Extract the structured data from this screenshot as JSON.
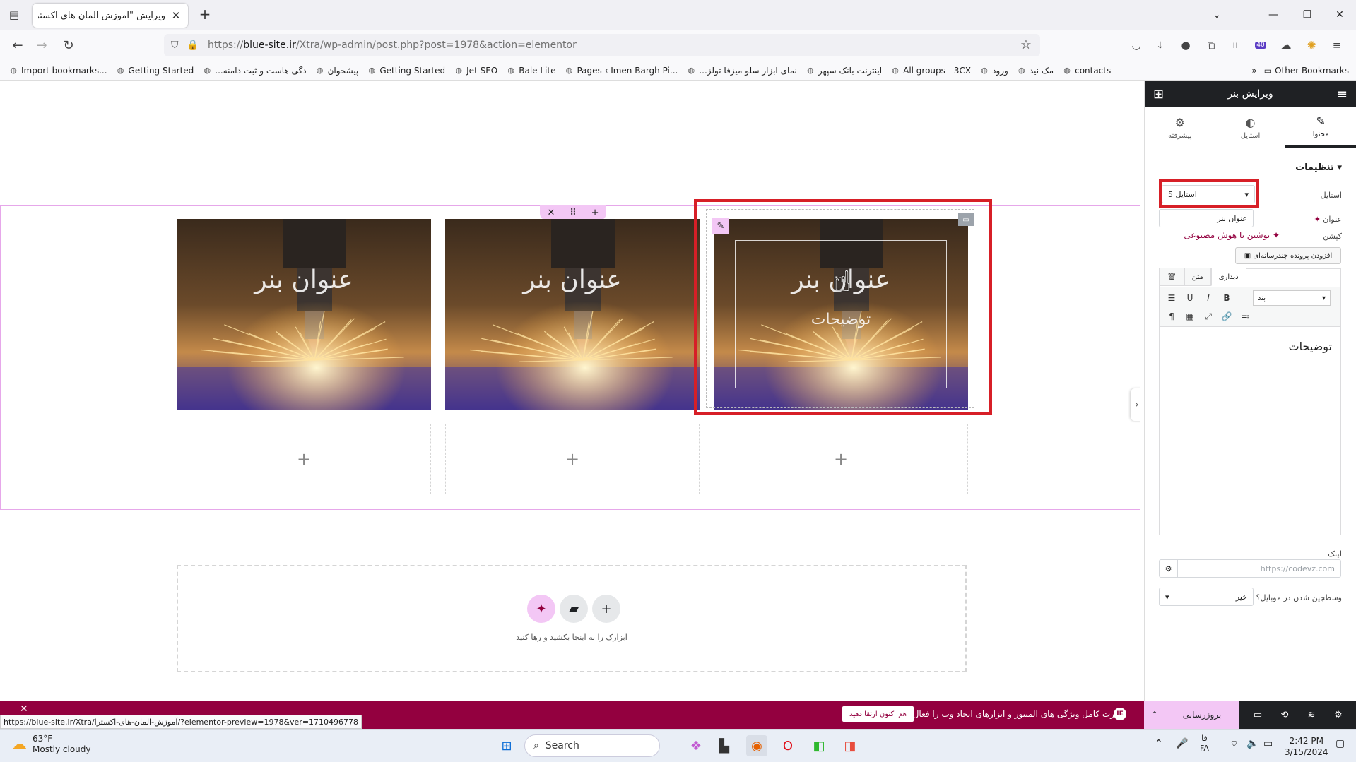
{
  "browser": {
    "tab_title": "ویرایش \"آموزش المان های اکسترا –",
    "url_prefix": "https://",
    "url_domain": "blue-site.ir",
    "url_path": "/Xtra/wp-admin/post.php?post=1978&action=elementor",
    "profile_badge": "40",
    "bookmarks": [
      "Import bookmarks...",
      "Getting Started",
      "...دگی هاست و ثبت دامنه",
      "پیشخوان",
      "Getting Started",
      "Jet SEO",
      "Bale Lite",
      "Pages ‹ Imen Bargh Pi...",
      "...نمای ابزار سلو میزفا تولز",
      "اینترنت بانک سپهر",
      "All groups - 3CX",
      "ورود",
      "مک نید",
      "contacts"
    ],
    "other_bookmarks": "Other Bookmarks"
  },
  "canvas": {
    "banners": [
      {
        "title": "عنوان بنر",
        "description": ""
      },
      {
        "title": "عنوان بنر",
        "description": ""
      },
      {
        "title": "عنوان بنر",
        "description": "توضیحات"
      }
    ],
    "add_symbol": "+",
    "drop_zone_text": "ابزارک را به اینجا بکشید و رها کنید"
  },
  "panel": {
    "title": "ویرایش بنر",
    "tabs": [
      {
        "label": "محتوا",
        "icon": "pencil-icon"
      },
      {
        "label": "استایل",
        "icon": "contrast-icon"
      },
      {
        "label": "پیشرفته",
        "icon": "gear-icon"
      }
    ],
    "section_title": "تنظیمات",
    "style_label": "استایل",
    "style_value": "استایل 5",
    "title_label": "عنوان",
    "title_value": "عنوان بنر",
    "caption_label": "کپشن",
    "ai_link": "نوشتن با هوش مصنوعی",
    "add_media": "افزودن پرونده چندرسانه‌ای",
    "editor_tab_visual": "دیداری",
    "editor_tab_text": "متن",
    "paragraph": "بند",
    "editor_content": "توضیحات",
    "link_label": "لینک",
    "link_placeholder": "https://codevz.com",
    "center_mobile_label": "وسطچین شدن در موبایل؟",
    "center_mobile_value": "خیر"
  },
  "bottom_bar": {
    "promo_text": "قدرت کامل ویژگی های المنتور و ابزارهای ایجاد وب را فعال کنید.",
    "promo_button": "هم اکنون ارتقا دهید",
    "update_button": "بروزرسانی",
    "status_url": "https://blue-site.ir/Xtra/آموزش-المان-های-اکسترا/?elementor-preview=1978&ver=1710496778"
  },
  "taskbar": {
    "temperature": "63°F",
    "weather": "Mostly cloudy",
    "search": "Search",
    "lang_top": "فا",
    "lang_bottom": "FA",
    "time": "2:42 PM",
    "date": "3/15/2024"
  },
  "colors": {
    "accent": "#93003f",
    "highlight": "#d71f27",
    "handle": "#f3c7f5",
    "panel_dark": "#1f2124"
  }
}
